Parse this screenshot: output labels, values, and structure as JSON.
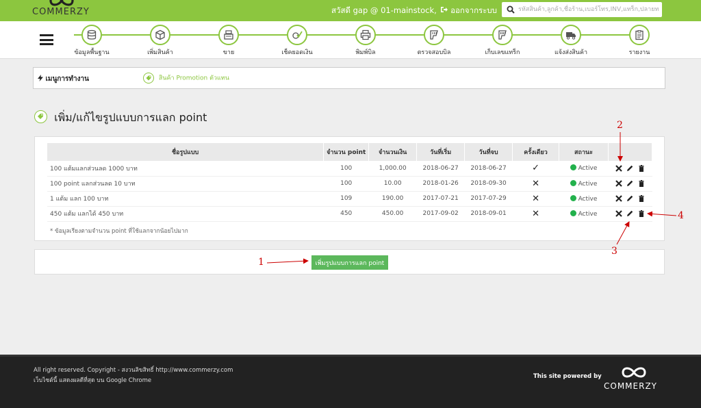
{
  "header": {
    "logo_text": "COMMERZY",
    "greeting": "สวัสดี gap @ 01-mainstock,",
    "logout_label": "ออกจากระบบ",
    "search_placeholder": "รหัสสินค้า,ลูกค้า,ชื่อร้าน,เบอร์โทร,INV,แทร็ก,ปลายทาง",
    "accent_color": "#8cc63f"
  },
  "nav": {
    "items": [
      {
        "label": "ข้อมูลพื้นฐาน",
        "icon": "database-icon"
      },
      {
        "label": "เพิ่มสินค้า",
        "icon": "box-icon"
      },
      {
        "label": "ขาย",
        "icon": "cash-register-icon"
      },
      {
        "label": "เช็คยอดเงิน",
        "icon": "check-money-icon"
      },
      {
        "label": "พิมพ์บิล",
        "icon": "printer-icon"
      },
      {
        "label": "ตรวจสอบบิล",
        "icon": "scanner-icon"
      },
      {
        "label": "เก็บเลขแทร็ก",
        "icon": "barcode-scanner-icon"
      },
      {
        "label": "แจ้งส่งสินค้า",
        "icon": "truck-icon"
      },
      {
        "label": "รายงาน",
        "icon": "report-icon"
      }
    ]
  },
  "menu": {
    "title": "เมนูการทำงาน",
    "promo_link": "สินค้า Promotion ตัวแทน"
  },
  "page": {
    "title": "เพิ่ม/แก้ไขรูปแบบการแลก point"
  },
  "table": {
    "headers": [
      "ชื่อรูปแบบ",
      "จำนวน point",
      "จำนวนเงิน",
      "วันที่เริ่ม",
      "วันที่จบ",
      "ครั้งเดียว",
      "สถานะ",
      ""
    ],
    "rows": [
      {
        "name": "100 แต้มแลกส่วนลด 1000 บาท",
        "points": "100",
        "amount": "1,000.00",
        "start": "2018-06-27",
        "end": "2018-06-27",
        "once": "✓",
        "status": "Active"
      },
      {
        "name": "100 point แลกส่วนลด 10 บาท",
        "points": "100",
        "amount": "10.00",
        "start": "2018-01-26",
        "end": "2018-09-30",
        "once": "✕",
        "status": "Active"
      },
      {
        "name": "1 แต้ม แลก 100 บาท",
        "points": "109",
        "amount": "190.00",
        "start": "2017-07-21",
        "end": "2017-07-29",
        "once": "✕",
        "status": "Active"
      },
      {
        "name": "450 แต้ม แลกได้ 450 บาท",
        "points": "450",
        "amount": "450.00",
        "start": "2017-09-02",
        "end": "2018-09-01",
        "once": "✕",
        "status": "Active"
      }
    ],
    "note": "* ข้อมูลเรียงตามจำนวน point ที่ใช้แลกจากน้อยไปมาก"
  },
  "add_button": "เพิ่มรูปแบบการแลก point",
  "annotations": [
    "1",
    "2",
    "3",
    "4"
  ],
  "footer": {
    "copyright": "All right reserved. Copyright - สงวนลิขสิทธิ์ http://www.commerzy.com",
    "browser_note": "เว็บไซต์นี้ แสดงผลดีที่สุด บน Google Chrome",
    "powered_by": "This site powered by",
    "logo_text": "COMMERZY"
  }
}
